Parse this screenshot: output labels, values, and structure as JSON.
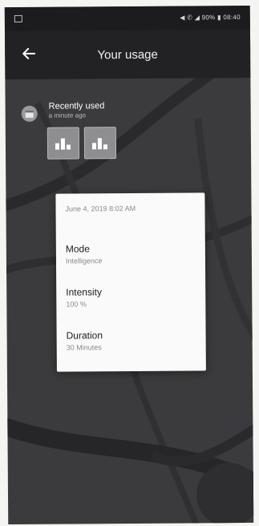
{
  "statusbar": {
    "right_text": "◀ ✆ ◢ 90% ▮ 08:40"
  },
  "appbar": {
    "title": "Your usage",
    "back_icon": "arrow-left-icon"
  },
  "recent": {
    "icon": "calendar-icon",
    "title": "Recently used",
    "subtitle": "a minute ago",
    "tiles": [
      {
        "icon": "bar-chart-icon"
      },
      {
        "icon": "bar-chart-icon"
      }
    ]
  },
  "card": {
    "date": "June 4, 2019 8:02 AM",
    "fields": [
      {
        "label": "Mode",
        "value": "Intelligence"
      },
      {
        "label": "Intensity",
        "value": "100 %"
      },
      {
        "label": "Duration",
        "value": "30 Minutes"
      }
    ]
  },
  "colors": {
    "app_bar": "#222224",
    "background": "#3b3b3d",
    "card": "#fafafa",
    "tile": "#8e8e90"
  }
}
